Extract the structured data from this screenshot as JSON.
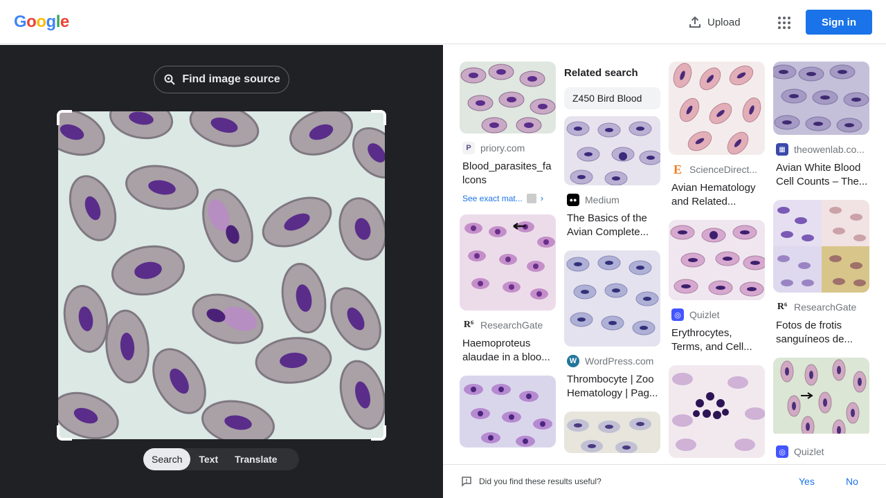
{
  "header": {
    "logo": [
      "G",
      "o",
      "o",
      "g",
      "l",
      "e"
    ],
    "logo_colors": [
      "#4285f4",
      "#ea4335",
      "#fbbc05",
      "#4285f4",
      "#34a853",
      "#ea4335"
    ],
    "upload_label": "Upload",
    "signin_label": "Sign in"
  },
  "left": {
    "find_source_label": "Find image source",
    "tabs": [
      "Search",
      "Text",
      "Translate"
    ],
    "active_tab": "Search"
  },
  "results": {
    "related_heading": "Related search",
    "related_chip": "Z450 Bird Blood",
    "cards": [
      {
        "id": "c1",
        "source": "priory.com",
        "title": "Blood_parasites_fa lcons",
        "exact": "See exact mat...",
        "color": "#c9a9c6"
      },
      {
        "id": "c2",
        "source": "ResearchGate",
        "title": "Haemoproteus alaudae in a bloo...",
        "color": "#c48fc9"
      },
      {
        "id": "c3",
        "source": "",
        "title": "",
        "color": "#b68ad0"
      },
      {
        "id": "c4",
        "source": "Medium",
        "title": "The Basics of the Avian Complete...",
        "color": "#b9b0d4"
      },
      {
        "id": "c5",
        "source": "WordPress.com",
        "title": "Thrombocyte | Zoo Hematology | Pag...",
        "color": "#aeb0d6"
      },
      {
        "id": "c6",
        "source": "",
        "title": "",
        "color": "#c2c0d4"
      },
      {
        "id": "c7",
        "source": "ScienceDirect...",
        "title": "Avian Hematology and Related...",
        "color": "#e2aeb8"
      },
      {
        "id": "c8",
        "source": "Quizlet",
        "title": "Erythrocytes, Terms, and Cell...",
        "color": "#d7a8cf"
      },
      {
        "id": "c9",
        "source": "",
        "title": "",
        "color": "#cfb2d6"
      },
      {
        "id": "c10",
        "source": "theowenlab.co...",
        "title": "Avian White Blood Cell Counts – The...",
        "color": "#a49ac4"
      },
      {
        "id": "c11",
        "source": "ResearchGate",
        "title": "Fotos de frotis sanguíneos de...",
        "color": "#caa2a8"
      },
      {
        "id": "c12",
        "source": "Quizlet",
        "title": "",
        "color": "#d1e1c7"
      }
    ]
  },
  "feedback": {
    "question": "Did you find these results useful?",
    "yes": "Yes",
    "no": "No"
  }
}
